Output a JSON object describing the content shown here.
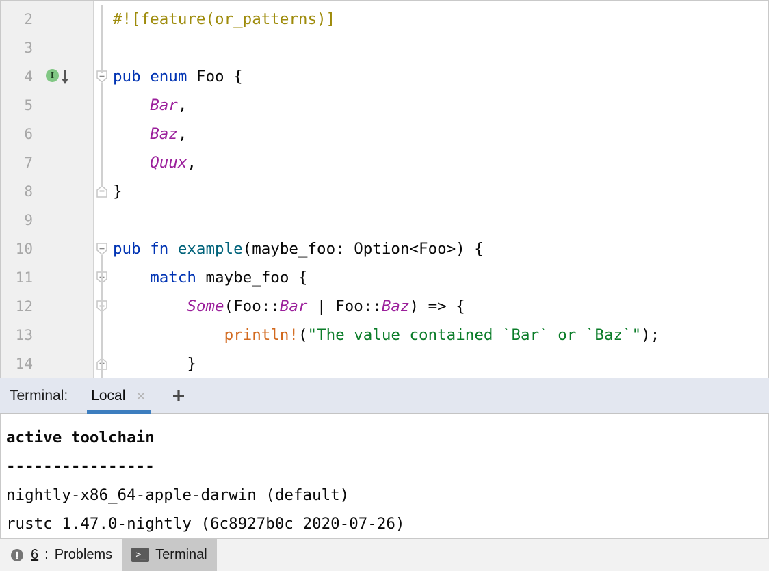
{
  "editor": {
    "first_line_number": 2,
    "lines": [
      {
        "num": "2",
        "fold": "none",
        "marker": null,
        "tokens": [
          {
            "t": "#![feature(or_patterns)]",
            "c": "attr"
          }
        ]
      },
      {
        "num": "3",
        "fold": "none",
        "marker": null,
        "tokens": []
      },
      {
        "num": "4",
        "fold": "start",
        "marker": "implementation-marker",
        "tokens": [
          {
            "t": "pub ",
            "c": "kw"
          },
          {
            "t": "enum ",
            "c": "kw"
          },
          {
            "t": "Foo {",
            "c": "plain"
          }
        ]
      },
      {
        "num": "5",
        "fold": "line",
        "marker": null,
        "tokens": [
          {
            "t": "    ",
            "c": "plain"
          },
          {
            "t": "Bar",
            "c": "enumv"
          },
          {
            "t": ",",
            "c": "plain"
          }
        ]
      },
      {
        "num": "6",
        "fold": "line",
        "marker": null,
        "tokens": [
          {
            "t": "    ",
            "c": "plain"
          },
          {
            "t": "Baz",
            "c": "enumv"
          },
          {
            "t": ",",
            "c": "plain"
          }
        ]
      },
      {
        "num": "7",
        "fold": "line",
        "marker": null,
        "tokens": [
          {
            "t": "    ",
            "c": "plain"
          },
          {
            "t": "Quux",
            "c": "enumv"
          },
          {
            "t": ",",
            "c": "plain"
          }
        ]
      },
      {
        "num": "8",
        "fold": "end",
        "marker": null,
        "tokens": [
          {
            "t": "}",
            "c": "plain"
          }
        ]
      },
      {
        "num": "9",
        "fold": "none",
        "marker": null,
        "tokens": []
      },
      {
        "num": "10",
        "fold": "start",
        "marker": null,
        "tokens": [
          {
            "t": "pub ",
            "c": "kw"
          },
          {
            "t": "fn ",
            "c": "kw"
          },
          {
            "t": "example",
            "c": "fname"
          },
          {
            "t": "(maybe_foo: Option<Foo>) {",
            "c": "plain"
          }
        ]
      },
      {
        "num": "11",
        "fold": "start",
        "marker": null,
        "tokens": [
          {
            "t": "    ",
            "c": "plain"
          },
          {
            "t": "match",
            "c": "kw"
          },
          {
            "t": " maybe_foo {",
            "c": "plain"
          }
        ]
      },
      {
        "num": "12",
        "fold": "start",
        "marker": null,
        "tokens": [
          {
            "t": "        ",
            "c": "plain"
          },
          {
            "t": "Some",
            "c": "enumv"
          },
          {
            "t": "(Foo::",
            "c": "plain"
          },
          {
            "t": "Bar",
            "c": "enumv"
          },
          {
            "t": " | Foo::",
            "c": "plain"
          },
          {
            "t": "Baz",
            "c": "enumv"
          },
          {
            "t": ") => {",
            "c": "plain"
          }
        ]
      },
      {
        "num": "13",
        "fold": "line",
        "marker": null,
        "tokens": [
          {
            "t": "            ",
            "c": "plain"
          },
          {
            "t": "println!",
            "c": "macro"
          },
          {
            "t": "(",
            "c": "plain"
          },
          {
            "t": "\"The value contained `Bar` or `Baz`\"",
            "c": "str"
          },
          {
            "t": ");",
            "c": "plain"
          }
        ]
      },
      {
        "num": "14",
        "fold": "end",
        "marker": null,
        "tokens": [
          {
            "t": "        }",
            "c": "plain"
          }
        ]
      }
    ]
  },
  "terminal_tabbar": {
    "label": "Terminal:",
    "tabs": [
      {
        "name": "Local",
        "active": true,
        "close_icon": "×"
      }
    ],
    "add_icon": "+"
  },
  "terminal_output": {
    "lines": [
      {
        "text": "active toolchain",
        "bold": true
      },
      {
        "text": "----------------",
        "bold": true
      },
      {
        "text": "nightly-x86_64-apple-darwin (default)",
        "bold": false
      },
      {
        "text": "rustc 1.47.0-nightly (6c8927b0c 2020-07-26)",
        "bold": false
      }
    ]
  },
  "statusbar": {
    "items": [
      {
        "id": "problems",
        "count": "6",
        "separator": ": ",
        "label": "Problems",
        "icon": "error-icon",
        "selected": false
      },
      {
        "id": "terminal",
        "count": "",
        "separator": "",
        "label": "Terminal",
        "icon": "terminal-icon",
        "selected": true
      }
    ]
  },
  "colors": {
    "keyword": "#0033b3",
    "attribute": "#9e8b0b",
    "enum_variant": "#9b1f9b",
    "function_name": "#00627a",
    "macro": "#d2691e",
    "string": "#0a7c28",
    "tab_accent": "#3d7ebf",
    "impl_marker": "#81c784",
    "gutter_bg": "#f0f0f0",
    "tabbar_bg": "#e3e7f0",
    "statusbar_bg": "#f2f2f2"
  }
}
